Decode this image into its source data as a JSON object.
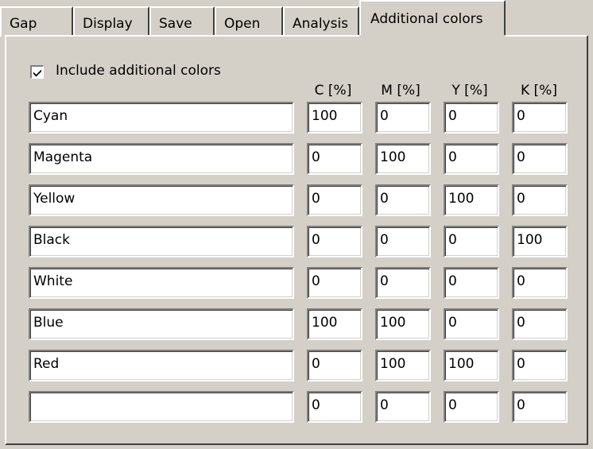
{
  "tabs": [
    {
      "label": "Gap",
      "active": false
    },
    {
      "label": "Display",
      "active": false
    },
    {
      "label": "Save",
      "active": false
    },
    {
      "label": "Open",
      "active": false
    },
    {
      "label": "Analysis",
      "active": false
    },
    {
      "label": "Additional colors",
      "active": true
    }
  ],
  "include_checkbox": {
    "label": "Include additional colors",
    "checked": true
  },
  "columns": [
    "C [%]",
    "M [%]",
    "Y [%]",
    "K [%]"
  ],
  "rows": [
    {
      "name": "Cyan",
      "c": "100",
      "m": "0",
      "y": "0",
      "k": "0"
    },
    {
      "name": "Magenta",
      "c": "0",
      "m": "100",
      "y": "0",
      "k": "0"
    },
    {
      "name": "Yellow",
      "c": "0",
      "m": "0",
      "y": "100",
      "k": "0"
    },
    {
      "name": "Black",
      "c": "0",
      "m": "0",
      "y": "0",
      "k": "100"
    },
    {
      "name": "White",
      "c": "0",
      "m": "0",
      "y": "0",
      "k": "0"
    },
    {
      "name": "Blue",
      "c": "100",
      "m": "100",
      "y": "0",
      "k": "0"
    },
    {
      "name": "Red",
      "c": "0",
      "m": "100",
      "y": "100",
      "k": "0"
    },
    {
      "name": "",
      "c": "0",
      "m": "0",
      "y": "0",
      "k": "0"
    }
  ],
  "colors": {
    "face": "#d4d0c8",
    "field": "#ffffff",
    "shadow": "#808080",
    "highlight": "#ffffff"
  }
}
